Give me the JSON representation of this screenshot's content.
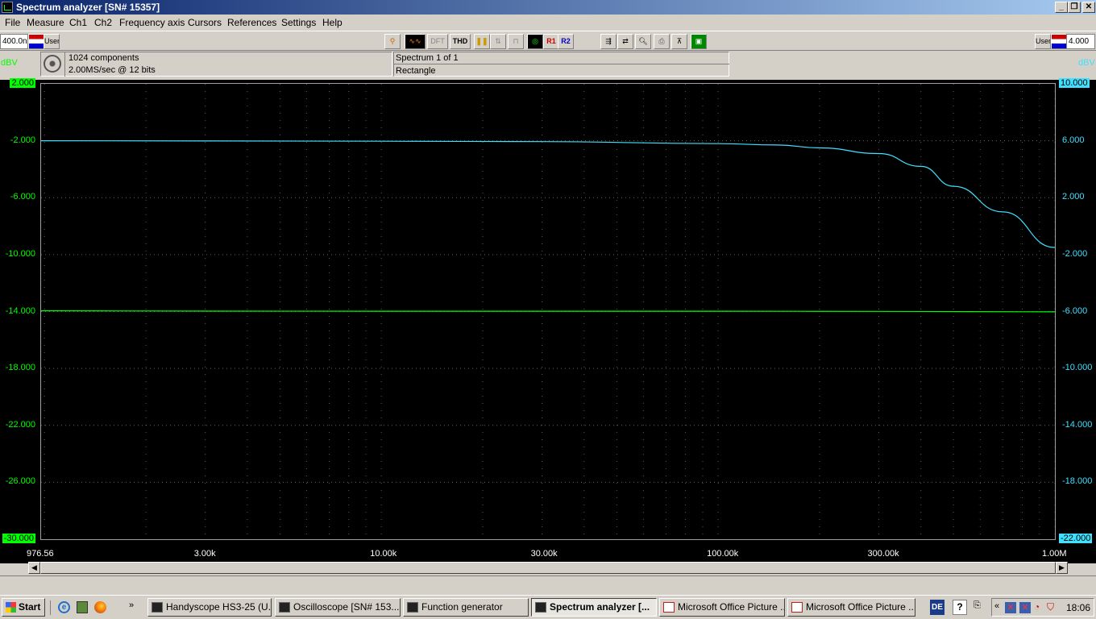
{
  "window": {
    "title": "Spectrum analyzer  [SN# 15357]"
  },
  "menu": [
    "File",
    "Measure",
    "Ch1",
    "Ch2",
    "Frequency axis",
    "Cursors",
    "References",
    "Settings",
    "Help"
  ],
  "toolbar": {
    "left_value": "400.0n",
    "left_user": "User",
    "right_user": "User",
    "right_value": "4.000",
    "dft": "DFT",
    "thd": "THD",
    "r1": "R1",
    "r2": "R2"
  },
  "info": {
    "components": "1024 components",
    "rate": "2.00MS/sec @ 12 bits",
    "spectrum": "Spectrum 1 of 1",
    "window": "Rectangle"
  },
  "axes": {
    "left_unit": "dBV",
    "right_unit": "dBV",
    "left_ticks": [
      "2.000",
      "-2.000",
      "-6.000",
      "-10.000",
      "-14.000",
      "-18.000",
      "-22.000",
      "-26.000",
      "-30.000"
    ],
    "right_ticks": [
      "10.000",
      "6.000",
      "2.000",
      "-2.000",
      "-6.000",
      "-10.000",
      "-14.000",
      "-18.000",
      "-22.000"
    ],
    "x_ticks": [
      "976.56",
      "3.00k",
      "10.00k",
      "30.00k",
      "100.00k",
      "300.00k",
      "1.00M"
    ]
  },
  "colors": {
    "ch1": "#00ff00",
    "ch2": "#40e0ff",
    "grid": "#c8c8c8",
    "plot_bg": "#000000"
  },
  "chart_data": {
    "type": "line",
    "x_scale": "log",
    "xlim": [
      976.56,
      1000000
    ],
    "ylim_left": [
      -30,
      2
    ],
    "ylim_right": [
      -22,
      10
    ],
    "series": [
      {
        "axis": "left",
        "x": [
          976.56,
          3000,
          10000,
          30000,
          100000,
          300000,
          1000000
        ],
        "y": [
          -13.95,
          -13.97,
          -13.98,
          -13.98,
          -13.98,
          -13.99,
          -14.02
        ]
      },
      {
        "axis": "right",
        "x": [
          976.56,
          10000,
          30000,
          100000,
          150000,
          200000,
          300000,
          400000,
          500000,
          700000,
          1000000
        ],
        "y": [
          6.0,
          5.97,
          5.94,
          5.8,
          5.7,
          5.5,
          5.1,
          4.2,
          2.8,
          1.0,
          -1.5
        ]
      }
    ]
  },
  "taskbar": {
    "start": "Start",
    "tasks": [
      "Handyscope HS3-25 (U...",
      "Oscilloscope  [SN# 153...",
      "Function generator",
      "Spectrum analyzer  [...",
      "Microsoft Office Picture ...",
      "Microsoft Office Picture ..."
    ],
    "lang": "DE",
    "clock": "18:06"
  }
}
